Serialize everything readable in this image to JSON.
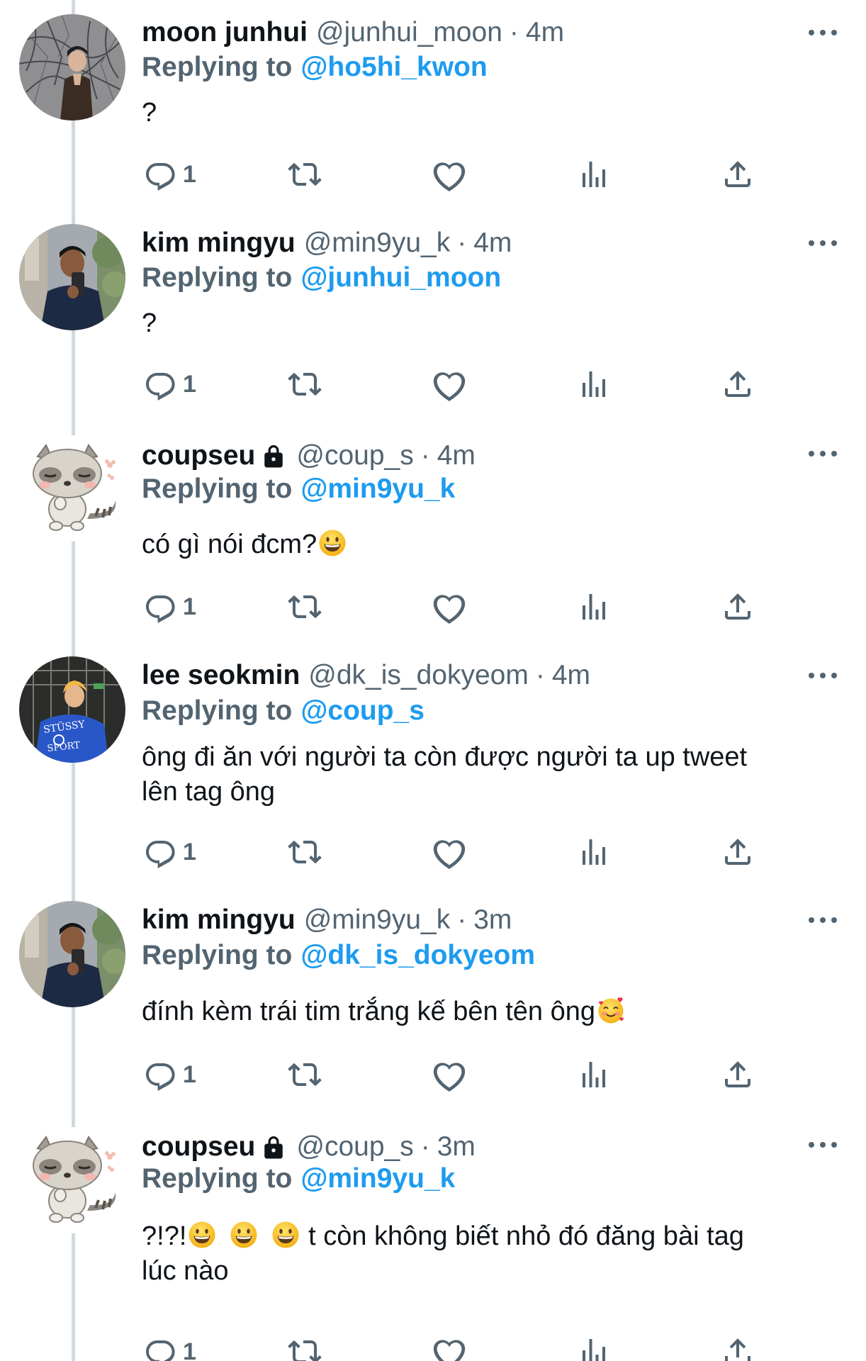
{
  "tweets": [
    {
      "display_name": "moon junhui",
      "handle": "@junhui_moon",
      "dot": "·",
      "time": "4m",
      "replying_label": "Replying to",
      "reply_to": "@ho5hi_kwon",
      "text": "?",
      "reply_count": "1",
      "locked": false,
      "avatar": "avatar-photo-bare-branches"
    },
    {
      "display_name": "kim mingyu",
      "handle": "@min9yu_k",
      "dot": "·",
      "time": "4m",
      "replying_label": "Replying to",
      "reply_to": "@junhui_moon",
      "text": "?",
      "reply_count": "1",
      "locked": false,
      "avatar": "avatar-photo-mirror-selfie"
    },
    {
      "display_name": "coupseu",
      "handle": "@coup_s",
      "dot": "·",
      "time": "4m",
      "replying_label": "Replying to",
      "reply_to": "@min9yu_k",
      "text": "có gì nói đcm?",
      "emoji": [
        "grinning-face-emoji"
      ],
      "reply_count": "1",
      "locked": true,
      "avatar": "avatar-raccoon-illustration"
    },
    {
      "display_name": "lee seokmin",
      "handle": "@dk_is_dokyeom",
      "dot": "·",
      "time": "4m",
      "replying_label": "Replying to",
      "reply_to": "@coup_s",
      "text_line1": "ông đi ăn với người ta còn được người ta up tweet",
      "text_line2": "lên tag ông",
      "reply_count": "1",
      "locked": false,
      "avatar": "avatar-photo-blue-jacket",
      "jacket_text_1": "STÜSSY",
      "jacket_text_2": "SPORT"
    },
    {
      "display_name": "kim mingyu",
      "handle": "@min9yu_k",
      "dot": "·",
      "time": "3m",
      "replying_label": "Replying to",
      "reply_to": "@dk_is_dokyeom",
      "text": "đính kèm trái tim trắng kế bên tên ông",
      "emoji": [
        "smiling-face-with-hearts-emoji"
      ],
      "reply_count": "1",
      "locked": false,
      "avatar": "avatar-photo-mirror-selfie"
    },
    {
      "display_name": "coupseu",
      "handle": "@coup_s",
      "dot": "·",
      "time": "3m",
      "replying_label": "Replying to",
      "reply_to": "@min9yu_k",
      "text_prefix": "?!?!",
      "text_suffix": " t còn không biết nhỏ đó đăng bài tag",
      "text_line2": "lúc nào",
      "emoji": [
        "grinning-face-emoji",
        "grinning-face-emoji",
        "grinning-face-emoji"
      ],
      "reply_count": "1",
      "locked": true,
      "avatar": "avatar-raccoon-illustration"
    }
  ],
  "icons": {
    "more": "more-options-icon",
    "reply": "reply-icon",
    "retweet": "retweet-icon",
    "like": "like-icon",
    "views": "views-icon",
    "share": "share-icon",
    "lock": "lock-icon"
  },
  "colors": {
    "text": "#0f1419",
    "secondary": "#536471",
    "link": "#1d9bf0",
    "thread_line": "#cfd9de",
    "background": "#ffffff"
  }
}
